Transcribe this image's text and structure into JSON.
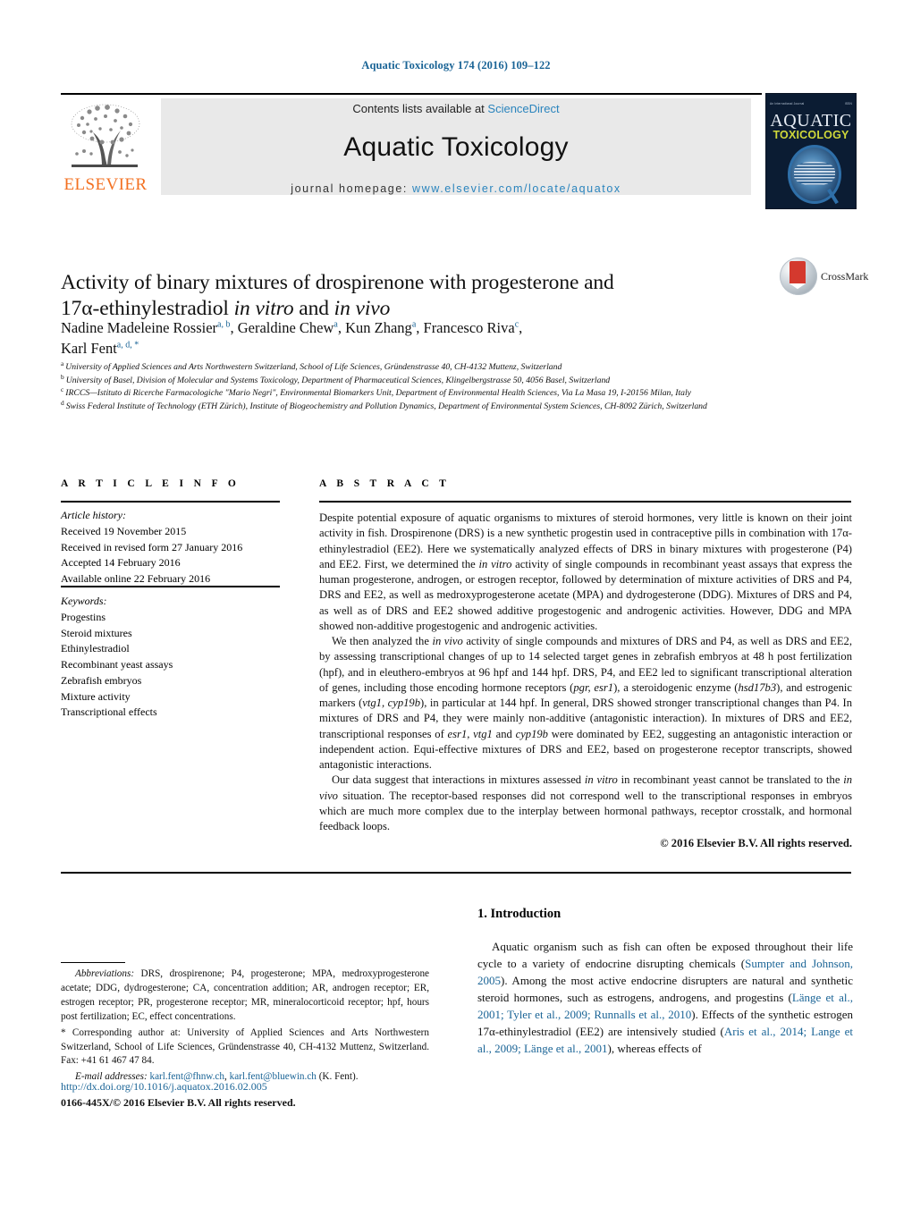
{
  "running_head": "Aquatic Toxicology 174 (2016) 109–122",
  "header": {
    "contents_prefix": "Contents lists available at ",
    "sciencedirect": "ScienceDirect",
    "journal_name": "Aquatic Toxicology",
    "homepage_label": "journal homepage: ",
    "homepage_url": "www.elsevier.com/locate/aquatox",
    "publisher_logo_text": "ELSEVIER",
    "cover": {
      "line1": "AQUATIC",
      "line2": "TOXICOLOGY",
      "corner_left": "An International Journal",
      "corner_right": "ISSN"
    },
    "accent_link_color": "#2a84bd"
  },
  "crossmark": {
    "label": "CrossMark"
  },
  "article": {
    "title_line1": "Activity of binary mixtures of drospirenone with progesterone and",
    "title_line2_a": "17α-ethinylestradiol ",
    "title_line2_italic1": "in vitro",
    "title_line2_b": " and ",
    "title_line2_italic2": "in vivo",
    "authors": [
      {
        "name": "Nadine Madeleine Rossier",
        "sup": "a, b"
      },
      {
        "name": "Geraldine Chew",
        "sup": "a"
      },
      {
        "name": "Kun Zhang",
        "sup": "a"
      },
      {
        "name": "Francesco Riva",
        "sup": "c"
      },
      {
        "name": "Karl Fent",
        "sup": "a, d, *"
      }
    ],
    "affiliations": [
      {
        "marker": "a",
        "text": "University of Applied Sciences and Arts Northwestern Switzerland, School of Life Sciences, Gründenstrasse 40, CH-4132 Muttenz, Switzerland"
      },
      {
        "marker": "b",
        "text": "University of Basel, Division of Molecular and Systems Toxicology, Department of Pharmaceutical Sciences, Klingelbergstrasse 50, 4056 Basel, Switzerland"
      },
      {
        "marker": "c",
        "text": "IRCCS—Istituto di Ricerche Farmacologiche \"Mario Negri\", Environmental Biomarkers Unit, Department of Environmental Health Sciences, Via La Masa 19, I-20156 Milan, Italy"
      },
      {
        "marker": "d",
        "text": "Swiss Federal Institute of Technology (ETH Zürich), Institute of Biogeochemistry and Pollution Dynamics, Department of Environmental System Sciences, CH-8092 Zürich, Switzerland"
      }
    ]
  },
  "article_info": {
    "heading": "A R T I C L E  I N F O",
    "history_label": "Article history:",
    "history": [
      "Received 19 November 2015",
      "Received in revised form 27 January 2016",
      "Accepted 14 February 2016",
      "Available online 22 February 2016"
    ],
    "keywords_label": "Keywords:",
    "keywords": [
      "Progestins",
      "Steroid mixtures",
      "Ethinylestradiol",
      "Recombinant yeast assays",
      "Zebrafish embryos",
      "Mixture activity",
      "Transcriptional effects"
    ]
  },
  "abstract": {
    "heading": "A B S T R A C T",
    "p1_a": "Despite potential exposure of aquatic organisms to mixtures of steroid hormones, very little is known on their joint activity in fish. Drospirenone (DRS) is a new synthetic progestin used in contraceptive pills in combination with 17α-ethinylestradiol (EE2). Here we systematically analyzed effects of DRS in binary mixtures with progesterone (P4) and EE2. First, we determined the ",
    "p1_i1": "in vitro",
    "p1_b": " activity of single compounds in recombinant yeast assays that express the human progesterone, androgen, or estrogen receptor, followed by determination of mixture activities of DRS and P4, DRS and EE2, as well as medroxyprogesterone acetate (MPA) and dydrogesterone (DDG). Mixtures of DRS and P4, as well as of DRS and EE2 showed additive progestogenic and androgenic activities. However, DDG and MPA showed non-additive progestogenic and androgenic activities.",
    "p2_a": "We then analyzed the ",
    "p2_i1": "in vivo",
    "p2_b": " activity of single compounds and mixtures of DRS and P4, as well as DRS and EE2, by assessing transcriptional changes of up to 14 selected target genes in zebrafish embryos at 48 h post fertilization (hpf), and in eleuthero-embryos at 96 hpf and 144 hpf. DRS, P4, and EE2 led to significant transcriptional alteration of genes, including those encoding hormone receptors (",
    "p2_i2": "pgr, esr1",
    "p2_c": "), a steroidogenic enzyme (",
    "p2_i3": "hsd17b3",
    "p2_d": "), and estrogenic markers (",
    "p2_i4": "vtg1, cyp19b",
    "p2_e": "), in particular at 144 hpf. In general, DRS showed stronger transcriptional changes than P4. In mixtures of DRS and P4, they were mainly non-additive (antagonistic interaction). In mixtures of DRS and EE2, transcriptional responses of ",
    "p2_i5": "esr1, vtg1",
    "p2_f": " and ",
    "p2_i6": "cyp19b",
    "p2_g": " were dominated by EE2, suggesting an antagonistic interaction or independent action. Equi-effective mixtures of DRS and EE2, based on progesterone receptor transcripts, showed antagonistic interactions.",
    "p3_a": "Our data suggest that interactions in mixtures assessed ",
    "p3_i1": "in vitro",
    "p3_b": " in recombinant yeast cannot be translated to the ",
    "p3_i2": "in vivo",
    "p3_c": " situation. The receptor-based responses did not correspond well to the transcriptional responses in embryos which are much more complex due to the interplay between hormonal pathways, receptor crosstalk, and hormonal feedback loops.",
    "copyright": "© 2016 Elsevier B.V. All rights reserved."
  },
  "introduction": {
    "heading": "1.  Introduction",
    "p1_a": "Aquatic organism such as fish can often be exposed throughout their life cycle to a variety of endocrine disrupting chemicals (",
    "cite1": "Sumpter and Johnson, 2005",
    "p1_b": "). Among the most active endocrine disrupters are natural and synthetic steroid hormones, such as estrogens, androgens, and progestins (",
    "cite2": "Länge et al., 2001; Tyler et al., 2009; Runnalls et al., 2010",
    "p1_c": "). Effects of the synthetic estrogen 17α-ethinylestradiol (EE2) are intensively studied (",
    "cite3": "Aris et al., 2014; Lange et al., 2009; Länge et al., 2001",
    "p1_d": "), whereas effects of"
  },
  "footnotes": {
    "abbrev_label": "Abbreviations:",
    "abbrev_text": "  DRS, drospirenone; P4, progesterone; MPA, medroxyprogesterone acetate; DDG, dydrogesterone; CA, concentration addition; AR, androgen receptor; ER, estrogen receptor; PR, progesterone receptor; MR, mineralocorticoid receptor; hpf, hours post fertilization; EC, effect concentrations.",
    "corresponding": "* Corresponding author at: University of Applied Sciences and Arts Northwestern Switzerland, School of Life Sciences, Gründenstrasse 40, CH-4132 Muttenz, Switzerland. Fax: +41 61 467 47 84.",
    "email_label": "E-mail addresses:",
    "email1": "karl.fent@fhnw.ch",
    "email_sep": ", ",
    "email2": "karl.fent@bluewin.ch",
    "email_suffix": " (K. Fent).",
    "doi": "http://dx.doi.org/10.1016/j.aquatox.2016.02.005",
    "issn": "0166-445X/© 2016 Elsevier B.V. All rights reserved."
  }
}
